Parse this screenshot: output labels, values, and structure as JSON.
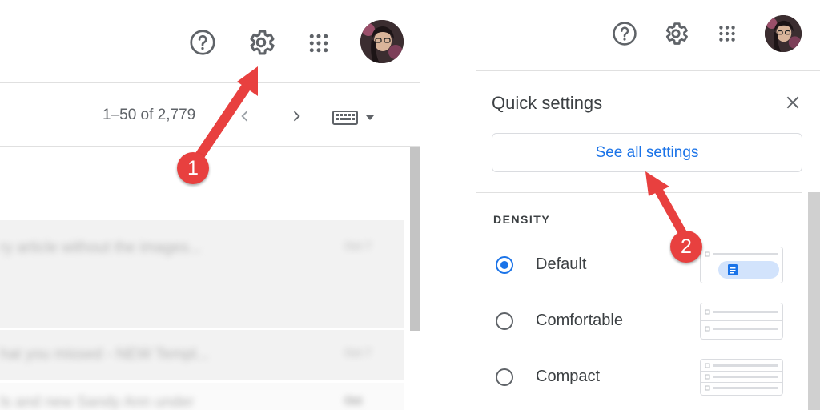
{
  "left": {
    "pager_text": "1–50 of 2,779",
    "rows": [
      {
        "text": "ry article without the images...",
        "date": "Oct 7"
      },
      {
        "text": "hat you missed - NEW Templ...",
        "date": "Oct 7"
      },
      {
        "text": "ls and new Sandy Ann under",
        "date": "Oct"
      }
    ]
  },
  "right": {
    "title": "Quick settings",
    "see_all_label": "See all settings",
    "density_heading": "DENSITY",
    "options": [
      {
        "label": "Default",
        "selected": true
      },
      {
        "label": "Comfortable",
        "selected": false
      },
      {
        "label": "Compact",
        "selected": false
      }
    ]
  },
  "annotations": {
    "marker_1": "1",
    "marker_2": "2"
  },
  "colors": {
    "accent_blue": "#1a73e8",
    "arrow_red": "#e8403f",
    "icon_gray": "#5f6368"
  },
  "icons": [
    "help-icon",
    "settings-gear-icon",
    "apps-grid-icon",
    "account-avatar",
    "chevron-left-icon",
    "chevron-right-icon",
    "keyboard-icon",
    "close-icon"
  ]
}
